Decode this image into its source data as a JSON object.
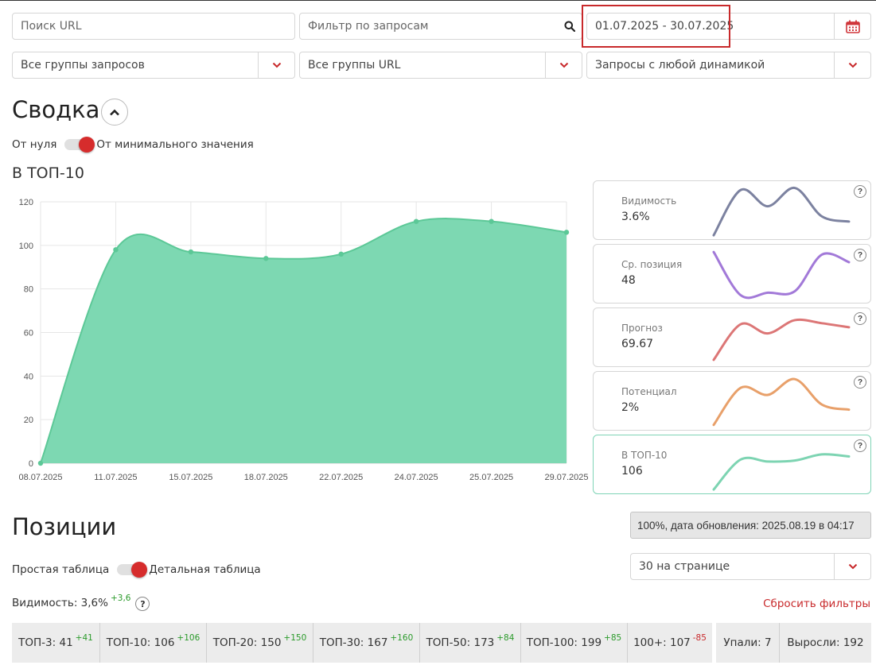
{
  "filters": {
    "url_search_placeholder": "Поиск URL",
    "query_filter_placeholder": "Фильтр по запросам",
    "date_range": "01.07.2025 - 30.07.2025",
    "query_groups": "Все группы запросов",
    "url_groups": "Все группы URL",
    "dynamics": "Запросы с любой динамикой"
  },
  "summary": {
    "title": "Сводка",
    "toggle_left": "От нуля",
    "toggle_right": "От минимального значения",
    "chart_title": "В ТОП-10"
  },
  "chart_data": {
    "type": "area",
    "title": "В ТОП-10",
    "x": [
      "08.07.2025",
      "11.07.2025",
      "15.07.2025",
      "18.07.2025",
      "22.07.2025",
      "24.07.2025",
      "25.07.2025",
      "29.07.2025"
    ],
    "y": [
      0,
      98,
      97,
      94,
      96,
      111,
      111,
      106
    ],
    "ylim": [
      0,
      120
    ],
    "yticks": [
      0,
      20,
      40,
      60,
      80,
      100,
      120
    ],
    "grid": true,
    "color": "#7dd8b2",
    "line_color": "#5cc897"
  },
  "metrics": [
    {
      "label": "Видимость",
      "value": "3.6%",
      "color": "#7c82a0",
      "trend": [
        3,
        92,
        60,
        96,
        40,
        30
      ]
    },
    {
      "label": "Ср. позиция",
      "value": "48",
      "color": "#a279d8",
      "trend": [
        95,
        10,
        15,
        18,
        90,
        75
      ]
    },
    {
      "label": "Прогноз",
      "value": "69.67",
      "color": "#dc7676",
      "trend": [
        8,
        78,
        60,
        86,
        80,
        72
      ]
    },
    {
      "label": "Потенциал",
      "value": "2%",
      "color": "#e8a06a",
      "trend": [
        5,
        78,
        64,
        95,
        45,
        35
      ]
    },
    {
      "label": "В ТОП-10",
      "value": "106",
      "color": "#7dd4b2",
      "trend": [
        3,
        62,
        58,
        60,
        72,
        68
      ]
    }
  ],
  "positions": {
    "title": "Позиции",
    "update_status": "100%, дата обновления: 2025.08.19 в 04:17",
    "toggle_left": "Простая таблица",
    "toggle_right": "Детальная таблица",
    "per_page": "30 на странице",
    "visibility_label": "Видимость: 3,6%",
    "visibility_delta": "+3,6",
    "reset_filters": "Сбросить фильтры",
    "stats": [
      {
        "label": "ТОП-3: 41",
        "delta": "+41",
        "trend": "pos"
      },
      {
        "label": "ТОП-10: 106",
        "delta": "+106",
        "trend": "pos"
      },
      {
        "label": "ТОП-20: 150",
        "delta": "+150",
        "trend": "pos"
      },
      {
        "label": "ТОП-30: 167",
        "delta": "+160",
        "trend": "pos"
      },
      {
        "label": "ТОП-50: 173",
        "delta": "+84",
        "trend": "pos"
      },
      {
        "label": "ТОП-100: 199",
        "delta": "+85",
        "trend": "pos"
      },
      {
        "label": "100+: 107",
        "delta": "-85",
        "trend": "neg"
      }
    ],
    "fell": "Упали: 7",
    "rose": "Выросли: 192"
  }
}
